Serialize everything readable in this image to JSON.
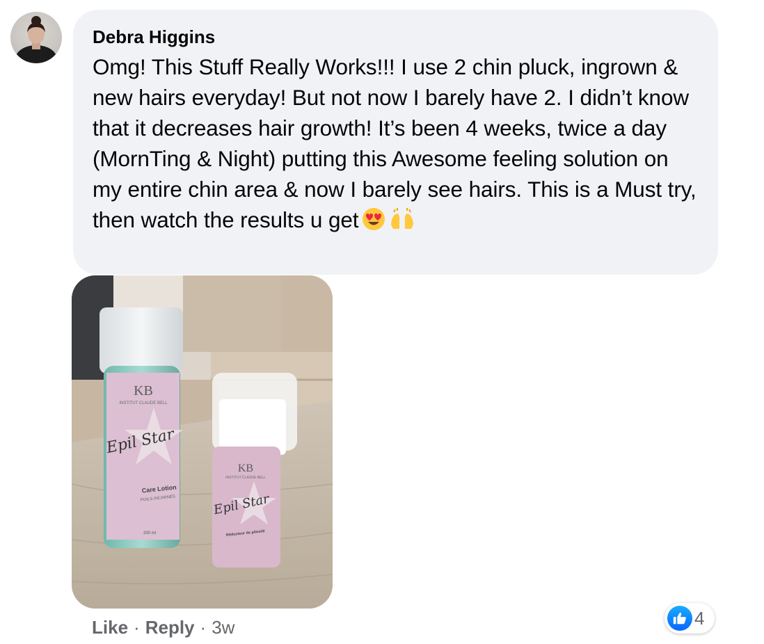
{
  "comment": {
    "author": "Debra Higgins",
    "text": "Omg! This Stuff Really Works!!! I use 2 chin pluck, ingrown & new hairs everyday! But not now I barely have 2. I didn’t know that it decreases hair growth! It’s been 4 weeks, twice a day (MornTing & Night) putting this Awesome feeling solution on my entire chin area & now I barely see hairs. This is a Must try, then watch the results u get",
    "emojis": [
      "heart-eyes-emoji",
      "raising-hands-emoji"
    ]
  },
  "photo": {
    "bottle_large": {
      "brand": "KB",
      "brand_name": "INSTITUT CLAUDE BELL",
      "product": "Epil Star",
      "label": "Care Lotion",
      "sub": "POILS INCARNÉS",
      "volume": "200 ml"
    },
    "bottle_small": {
      "brand": "KB",
      "brand_name": "INSTITUT CLAUDE BELL",
      "product": "Epil Star",
      "label": "Réducteur de pilosité"
    }
  },
  "actions": {
    "like_label": "Like",
    "reply_label": "Reply",
    "separator": "·",
    "time": "3w"
  },
  "reactions": {
    "icon": "thumbs-up-icon",
    "count": "4",
    "color": "#0866ff"
  },
  "colors": {
    "bubble": "#f0f2f5",
    "meta_text": "#65676b"
  }
}
